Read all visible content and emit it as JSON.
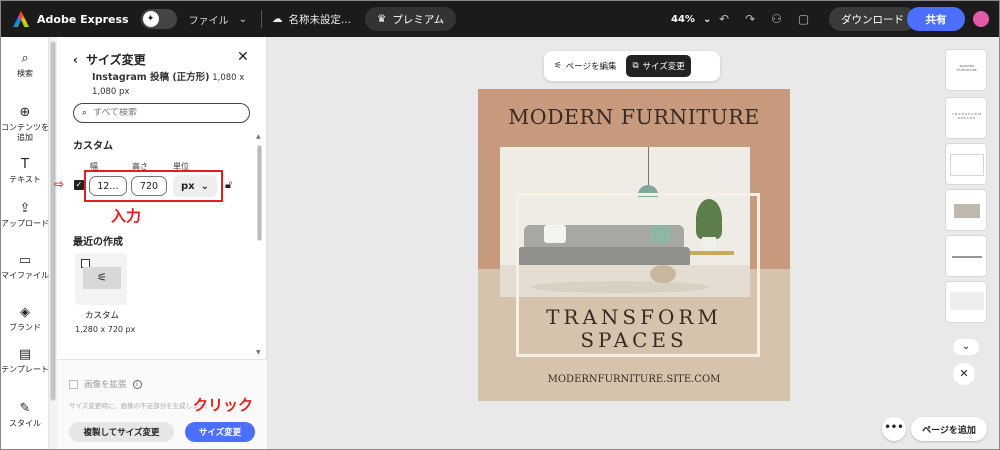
{
  "topbar": {
    "brand": "Adobe Express",
    "file_menu": "ファイル",
    "doc_name": "名称未設定...",
    "premium": "プレミアム",
    "zoom": "44%",
    "download": "ダウンロード",
    "share": "共有"
  },
  "rail": {
    "items": [
      {
        "icon": "⌕",
        "label": "検索"
      },
      {
        "icon": "⊕",
        "label": "コンテンツを追加"
      },
      {
        "icon": "T",
        "label": "テキスト"
      },
      {
        "icon": "⇪",
        "label": "アップロード"
      },
      {
        "icon": "▭",
        "label": "マイファイル"
      },
      {
        "icon": "◈",
        "label": "ブランド"
      },
      {
        "icon": "▤",
        "label": "テンプレート"
      },
      {
        "icon": "✎",
        "label": "スタイル"
      }
    ]
  },
  "panel": {
    "title": "サイズ変更",
    "preset_name": "Instagram 投稿 (正方形)",
    "preset_dims_a": "1,080 x",
    "preset_dims_b": "1,080 px",
    "search_placeholder": "すべて検索",
    "custom_title": "カスタム",
    "width_label": "幅",
    "height_label": "高さ",
    "unit_label": "単位",
    "width_value": "12…",
    "height_value": "720",
    "unit_value": "px",
    "annotation_input": "入力",
    "annotation_click": "クリック",
    "recent_title": "最近の作成",
    "recent_item_name": "カスタム",
    "recent_item_size": "1,280 x 720 px",
    "expand_label": "画像を拡張",
    "foot_note": "サイズ変更時に、画像の不足部分を生成します。",
    "duplicate_button": "複製してサイズ変更",
    "resize_button": "サイズ変更"
  },
  "canvas": {
    "edit_page": "ページを編集",
    "resize": "サイズ変更",
    "design": {
      "title": "MODERN FURNITURE",
      "line1": "TRANSFORM",
      "line2": "SPACES",
      "url": "MODERNFURNITURE.SITE.COM"
    }
  },
  "thumbs": {
    "thumb1_text": "MODERN FURNITURE",
    "thumb2_text": "TRANSFORM SPACES"
  },
  "actions": {
    "more": "•••",
    "add_page": "ページを追加"
  }
}
